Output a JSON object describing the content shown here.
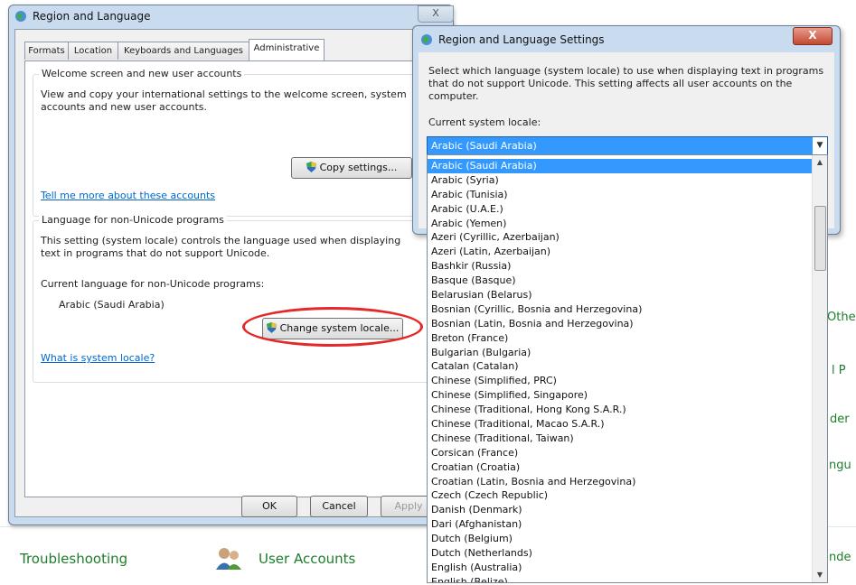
{
  "background": {
    "troubleshooting": "Troubleshooting",
    "user_accounts": "User Accounts",
    "right_fragments": [
      "Othe",
      "l P",
      "der",
      "ngu",
      "nde"
    ]
  },
  "main_dialog": {
    "title": "Region and Language",
    "close_glyph": "X",
    "tabs": [
      "Formats",
      "Location",
      "Keyboards and Languages",
      "Administrative"
    ],
    "welcome_group": {
      "title": "Welcome screen and new user accounts",
      "text1": "View and copy your international settings to the welcome screen, system",
      "text2": "accounts and new user accounts.",
      "copy_button": "Copy settings...",
      "link": "Tell me more about these accounts"
    },
    "unicode_group": {
      "title": "Language for non-Unicode programs",
      "text1": "This setting (system locale) controls the language used when displaying",
      "text2": "text in programs that do not support Unicode.",
      "current_label": "Current language for non-Unicode programs:",
      "current_value": "Arabic (Saudi Arabia)",
      "change_button": "Change system locale...",
      "link": "What is system locale?"
    },
    "buttons": {
      "ok": "OK",
      "cancel": "Cancel",
      "apply": "Apply"
    }
  },
  "locale_dialog": {
    "title": "Region and Language Settings",
    "close_glyph": "X",
    "description1": "Select which language (system locale) to use when displaying text in programs",
    "description2": "that do not support Unicode. This setting affects all user accounts on the",
    "description3": "computer.",
    "current_label": "Current system locale:",
    "selected_value": "Arabic (Saudi Arabia)",
    "options": [
      "Arabic (Saudi Arabia)",
      "Arabic (Syria)",
      "Arabic (Tunisia)",
      "Arabic (U.A.E.)",
      "Arabic (Yemen)",
      "Azeri (Cyrillic, Azerbaijan)",
      "Azeri (Latin, Azerbaijan)",
      "Bashkir (Russia)",
      "Basque (Basque)",
      "Belarusian (Belarus)",
      "Bosnian (Cyrillic, Bosnia and Herzegovina)",
      "Bosnian (Latin, Bosnia and Herzegovina)",
      "Breton (France)",
      "Bulgarian (Bulgaria)",
      "Catalan (Catalan)",
      "Chinese (Simplified, PRC)",
      "Chinese (Simplified, Singapore)",
      "Chinese (Traditional, Hong Kong S.A.R.)",
      "Chinese (Traditional, Macao S.A.R.)",
      "Chinese (Traditional, Taiwan)",
      "Corsican (France)",
      "Croatian (Croatia)",
      "Croatian (Latin, Bosnia and Herzegovina)",
      "Czech (Czech Republic)",
      "Danish (Denmark)",
      "Dari (Afghanistan)",
      "Dutch (Belgium)",
      "Dutch (Netherlands)",
      "English (Australia)",
      "English (Belize)"
    ],
    "selected_index": 0
  },
  "colors": {
    "selection": "#3399ff",
    "link": "#0066cc",
    "highlight_ellipse": "#e52828",
    "control_panel_text": "#1e7d2c"
  }
}
